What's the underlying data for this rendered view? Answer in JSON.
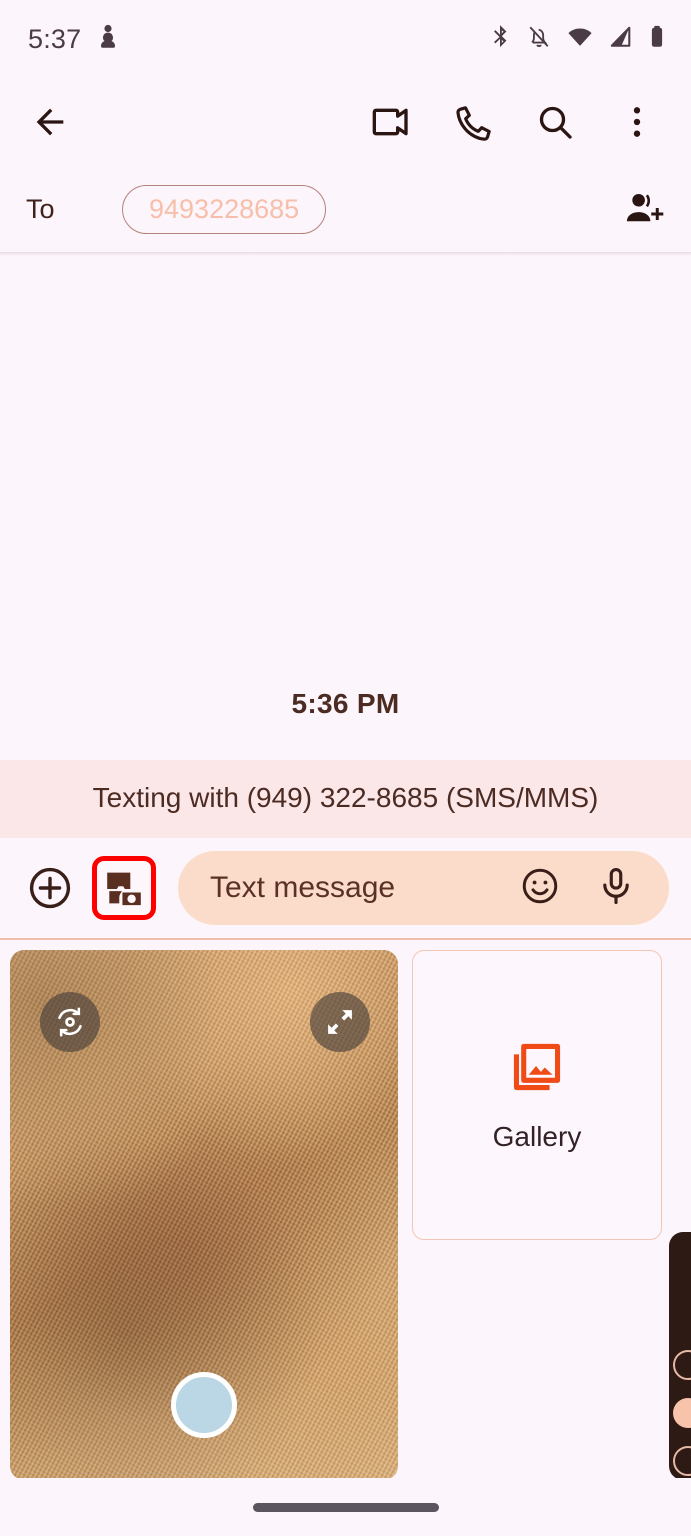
{
  "status_bar": {
    "time": "5:37",
    "notification_icon": "app-notification-icon",
    "icons": [
      "bluetooth-icon",
      "notifications-off-icon",
      "wifi-icon",
      "cellular-signal-icon",
      "battery-icon"
    ]
  },
  "app_bar": {
    "back": "back-arrow-icon",
    "video_call": "video-call-icon",
    "call": "phone-call-icon",
    "search": "search-icon",
    "more": "more-options-icon"
  },
  "recipient": {
    "to_label": "To",
    "chip_value": "9493228685",
    "add_contact": "add-person-icon",
    "chip_text_color": "#F7BFA9",
    "chip_border_color": "#B3837A"
  },
  "conversation": {
    "timestamp": "5:36 PM",
    "sms_banner": "Texting with (949) 322-8685 (SMS/MMS)",
    "banner_bg": "#FBE6E8"
  },
  "compose": {
    "add_label": "plus-icon",
    "camera_label": "camera-gallery-icon",
    "placeholder": "Text message",
    "emoji": "emoji-icon",
    "mic": "microphone-icon",
    "highlight_color": "#FF0000",
    "field_bg": "#FBDCCB"
  },
  "camera_tray": {
    "flip_camera": "flip-camera-icon",
    "expand": "expand-icon",
    "shutter": "shutter-button",
    "shutter_color": "#BBD6E4",
    "gallery_label": "Gallery",
    "gallery_icon": "photo-library-icon",
    "gallery_icon_color": "#F04A17"
  },
  "nav_bar": {
    "handle": "home-gesture-handle"
  }
}
